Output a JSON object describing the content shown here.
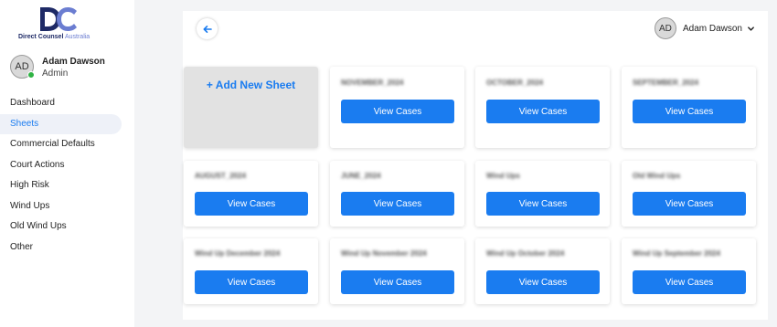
{
  "brand": {
    "logo_mark": "DC",
    "name_part1": "Direct Counsel",
    "name_part2": " Australia"
  },
  "user": {
    "initials": "AD",
    "name": "Adam Dawson",
    "role": "Admin",
    "status_color": "#2fb344"
  },
  "nav": {
    "items": [
      {
        "label": "Dashboard"
      },
      {
        "label": "Sheets",
        "active": true
      },
      {
        "label": "Commercial Defaults"
      },
      {
        "label": "Court Actions"
      },
      {
        "label": "High Risk"
      },
      {
        "label": "Wind Ups"
      },
      {
        "label": "Old Wind Ups"
      },
      {
        "label": "Other"
      }
    ]
  },
  "topbar": {
    "back_icon": "arrow-left-icon",
    "user_initials": "AD",
    "user_name": "Adam Dawson",
    "dropdown_icon": "chevron-down-icon"
  },
  "sheets": {
    "add_label": "+ Add New Sheet",
    "button_label": "View Cases",
    "cards": [
      {
        "title": "NOVEMBER_2024"
      },
      {
        "title": "OCTOBER_2024"
      },
      {
        "title": "SEPTEMBER_2024"
      },
      {
        "title": "AUGUST_2024"
      },
      {
        "title": "JUNE_2024"
      },
      {
        "title": "Wind Ups"
      },
      {
        "title": "Old Wind Ups"
      },
      {
        "title": "Wind Up December 2024"
      },
      {
        "title": "Wind Up November 2024"
      },
      {
        "title": "Wind Up October 2024"
      },
      {
        "title": "Wind Up September 2024"
      }
    ]
  },
  "colors": {
    "accent": "#1a7cf0",
    "brand_dark": "#1e2a66",
    "brand_light": "#6b7dd1"
  }
}
